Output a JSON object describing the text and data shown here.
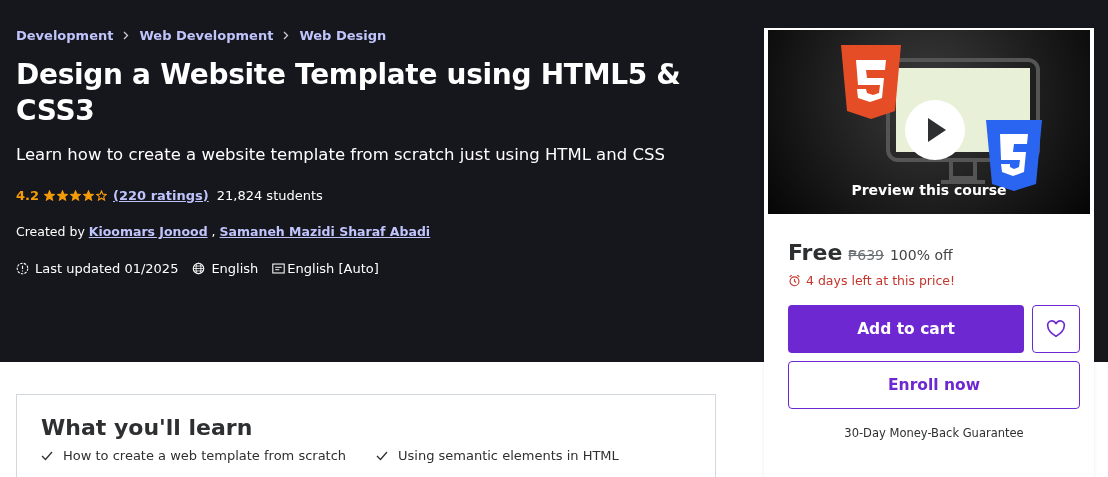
{
  "breadcrumbs": [
    "Development",
    "Web Development",
    "Web Design"
  ],
  "title": "Design a Website Template using HTML5 & CSS3",
  "subtitle": "Learn how to create a website template from scratch just using HTML and CSS",
  "rating": {
    "score": "4.2",
    "stars": 4,
    "ratings_link": "(220 ratings)",
    "students": "21,824 students"
  },
  "created_by": {
    "label": "Created by",
    "authors": [
      "Kioomars Jonood",
      "Samaneh Mazidi Sharaf Abadi"
    ],
    "separator": ","
  },
  "meta": {
    "last_updated": "Last updated 01/2025",
    "language": "English",
    "captions": "English [Auto]"
  },
  "purchase_card": {
    "preview_label": "Preview this course",
    "price": "Free",
    "original_price": "₱639",
    "discount": "100% off",
    "deadline": "4 days left at this price!",
    "add_to_cart": "Add to cart",
    "enroll": "Enroll now",
    "guarantee": "30-Day Money-Back Guarantee"
  },
  "learn": {
    "heading": "What you'll learn",
    "items": [
      "How to create a web template from scratch",
      "Using semantic elements in HTML"
    ]
  }
}
